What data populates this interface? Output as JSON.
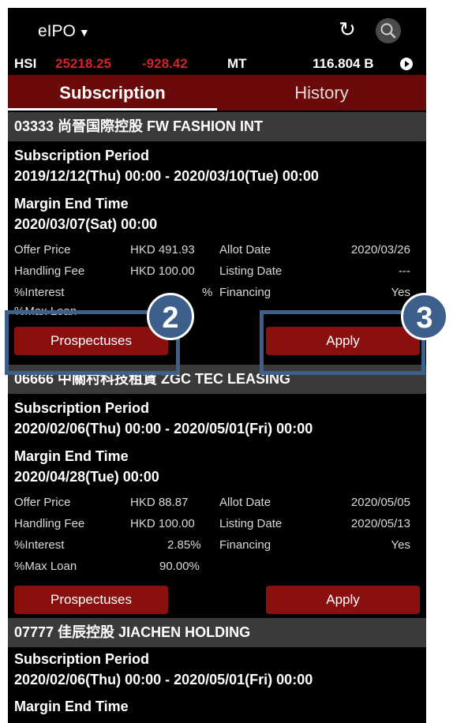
{
  "header": {
    "title": "eIPO",
    "caret": "▼",
    "refresh_icon": "↻"
  },
  "ticker": {
    "index": "HSI",
    "value": "25218.25",
    "change": "-928.42",
    "mt_label": "MT",
    "turnover": "116.804 B"
  },
  "tabs": [
    {
      "label": "Subscription"
    },
    {
      "label": "History"
    }
  ],
  "ipos": [
    {
      "code_name": "03333  尚晉国際控股 FW FASHION INT",
      "period_label": "Subscription Period",
      "period": "2019/12/12(Thu) 00:00 - 2020/03/10(Tue) 00:00",
      "margin_label": "Margin End Time",
      "margin": "2020/03/07(Sat) 00:00",
      "offer_label": "Offer Price",
      "offer": "HKD 491.93",
      "allot_label": "Allot Date",
      "allot": "2020/03/26",
      "fee_label": "Handling Fee",
      "fee": "HKD 100.00",
      "listing_label": "Listing Date",
      "listing": "---",
      "interest_label": "%Interest",
      "interest": "%",
      "financing_label": "Financing",
      "financing": "Yes",
      "maxloan_label": "%Max Loan",
      "prospectus_button": "Prospectuses",
      "apply_button": "Apply"
    },
    {
      "code_name": "06666  中關村科技租賃 ZGC TEC LEASING",
      "period_label": "Subscription Period",
      "period": "2020/02/06(Thu) 00:00 - 2020/05/01(Fri) 00:00",
      "margin_label": "Margin End Time",
      "margin": "2020/04/28(Tue) 00:00",
      "offer_label": "Offer Price",
      "offer": "HKD  88.87",
      "allot_label": "Allot Date",
      "allot": "2020/05/05",
      "fee_label": "Handling Fee",
      "fee": "HKD 100.00",
      "listing_label": "Listing Date",
      "listing": "2020/05/13",
      "interest_label": "%Interest",
      "interest": "2.85%",
      "financing_label": "Financing",
      "financing": "Yes",
      "maxloan_label": "%Max Loan",
      "maxloan": "90.00%",
      "prospectus_button": "Prospectuses",
      "apply_button": "Apply"
    },
    {
      "code_name": "07777  佳辰控股 JIACHEN HOLDING",
      "period_label": "Subscription Period",
      "period": "2020/02/06(Thu) 00:00 - 2020/05/01(Fri) 00:00",
      "margin_label": "Margin End Time"
    }
  ],
  "callouts": [
    {
      "number": "2"
    },
    {
      "number": "3"
    }
  ],
  "colors": {
    "accent": "#8a0f0f",
    "tab_bar": "#6a0a0a",
    "callout": "#3d5f8c",
    "negative": "#d2232a"
  }
}
